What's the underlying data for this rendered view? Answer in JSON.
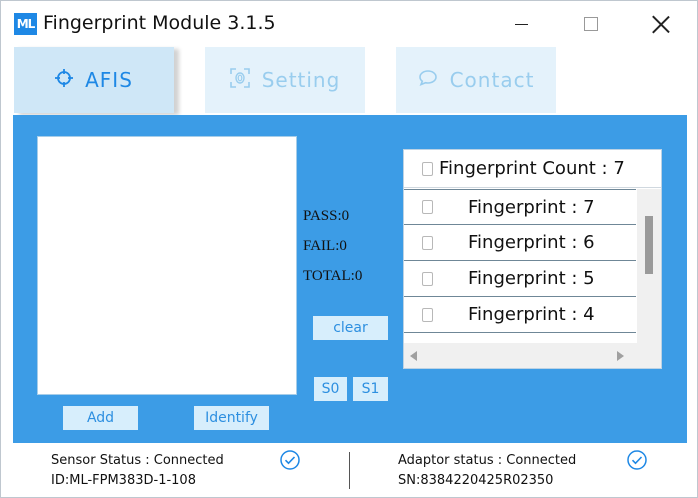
{
  "window": {
    "logo": "ML",
    "title": "Fingerprint Module 3.1.5"
  },
  "tabs": [
    {
      "label": "AFIS",
      "icon": "crosshair-icon",
      "active": true
    },
    {
      "label": "Setting",
      "icon": "fingerprint-scan-icon",
      "active": false
    },
    {
      "label": "Contact",
      "icon": "chat-bubble-icon",
      "active": false
    }
  ],
  "stats": {
    "pass": "PASS:0",
    "fail": "FAIL:0",
    "total": "TOTAL:0"
  },
  "buttons": {
    "clear": "clear",
    "s0": "S0",
    "s1": "S1",
    "add": "Add",
    "identify": "Identify"
  },
  "fingerprint_list": {
    "header": "Fingerprint Count : 7",
    "items": [
      "Fingerprint : 7",
      "Fingerprint : 6",
      "Fingerprint : 5",
      "Fingerprint : 4"
    ]
  },
  "status": {
    "sensor_status": "Sensor Status : Connected",
    "sensor_id": "ID:ML-FPM383D-1-108",
    "adaptor_status": "Adaptor status : Connected",
    "adaptor_sn": "SN:8384220425R02350"
  },
  "colors": {
    "accent": "#1e88e5",
    "panel": "#3c9ce6",
    "button_bg": "#d7eefc"
  }
}
